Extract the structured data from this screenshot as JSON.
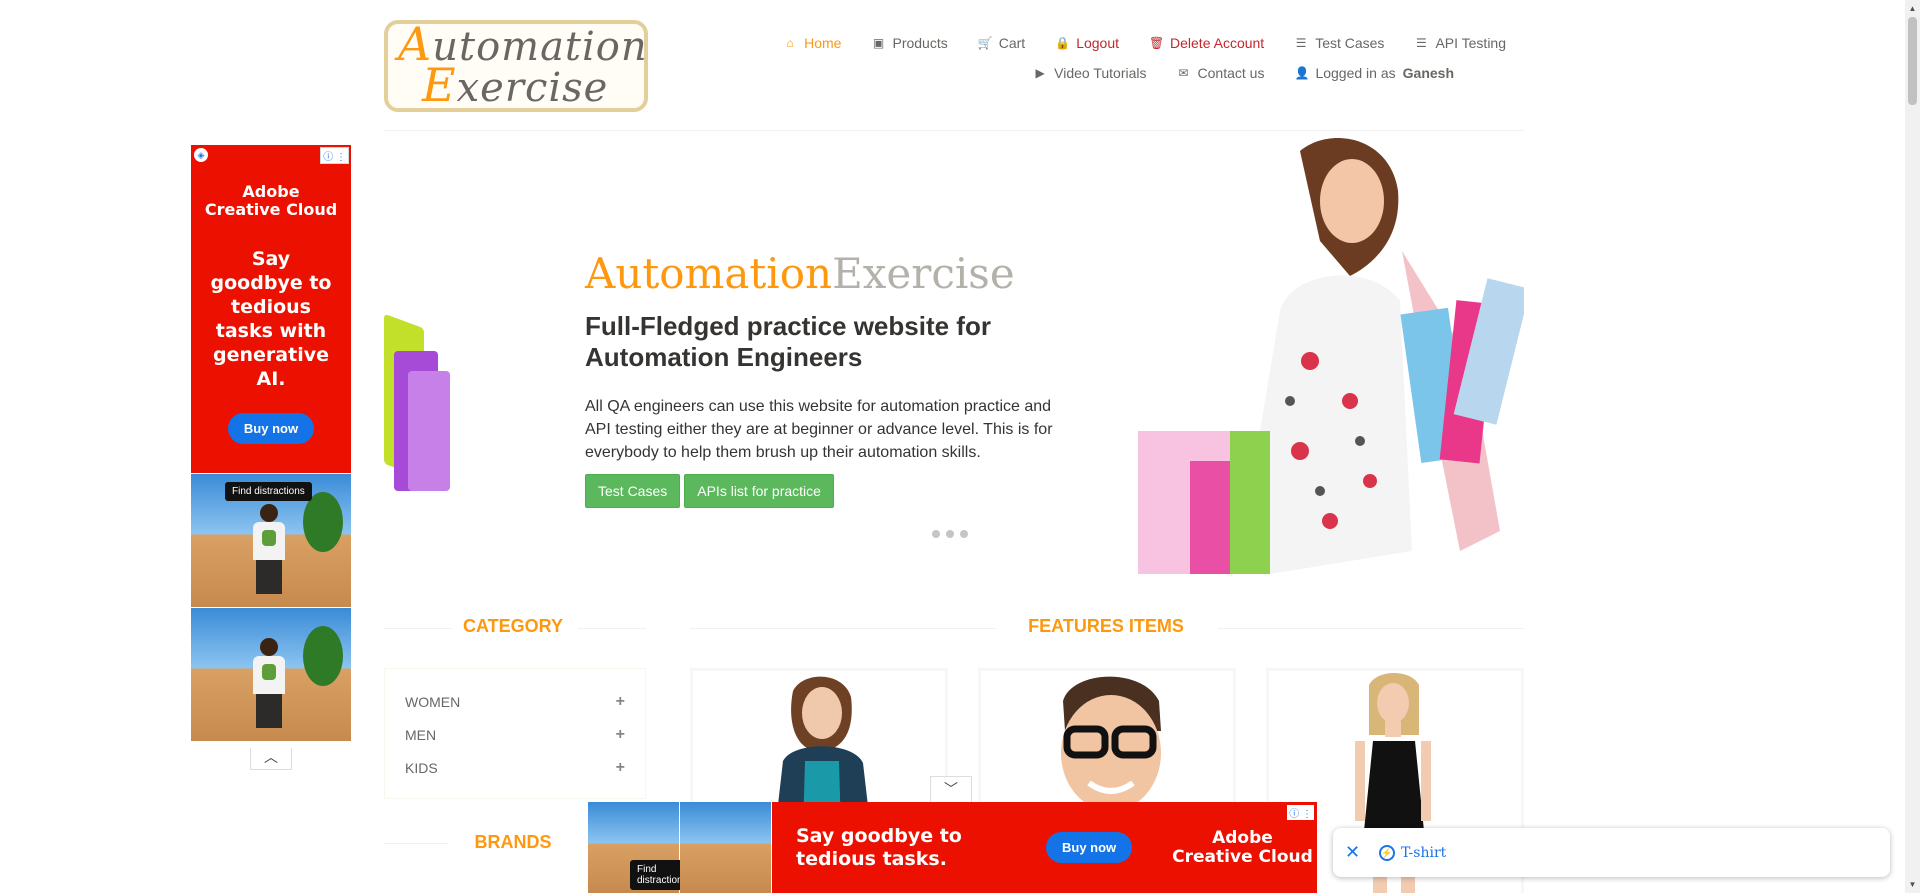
{
  "header": {
    "logo_line1_cap": "A",
    "logo_line1_rest": "utomation",
    "logo_line2_cap": "E",
    "logo_line2_rest": "xercise",
    "nav_row1": [
      {
        "icon": "home-icon",
        "glyph": "⌂",
        "label": "Home"
      },
      {
        "icon": "briefcase-icon",
        "glyph": "▣",
        "label": "Products"
      },
      {
        "icon": "cart-icon",
        "glyph": "🛒",
        "label": "Cart"
      },
      {
        "icon": "lock-icon",
        "glyph": "🔒",
        "label": "Logout"
      },
      {
        "icon": "trash-icon",
        "glyph": "🗑",
        "label": "Delete Account"
      },
      {
        "icon": "list-icon",
        "glyph": "☰",
        "label": "Test Cases"
      },
      {
        "icon": "list-icon",
        "glyph": "☰",
        "label": "API Testing"
      }
    ],
    "nav_row2": [
      {
        "icon": "video-icon",
        "glyph": "▶",
        "label": "Video Tutorials"
      },
      {
        "icon": "envelope-icon",
        "glyph": "✉",
        "label": "Contact us"
      },
      {
        "icon": "user-icon",
        "glyph": "👤",
        "label": "Logged in as",
        "user": "Ganesh"
      }
    ]
  },
  "slider": {
    "title_a": "Automation",
    "title_b": "Exercise",
    "subtitle": "Full-Fledged practice website for Automation Engineers",
    "description": "All QA engineers can use this website for automation practice and API testing either they are at beginner or advance level. This is for everybody to help them brush up their automation skills.",
    "btn_test_cases": "Test Cases",
    "btn_apis": "APIs list for practice",
    "active_slide": 1,
    "slide_count": 3
  },
  "category": {
    "title": "CATEGORY",
    "items": [
      "WOMEN",
      "MEN",
      "KIDS"
    ]
  },
  "brands": {
    "title": "BRANDS"
  },
  "features": {
    "title": "FEATURES ITEMS"
  },
  "ads": {
    "left": {
      "brand_line1": "Adobe",
      "brand_line2": "Creative Cloud",
      "headline": "Say goodbye to tedious tasks with generative AI.",
      "cta": "Buy now",
      "find": "Find distractions",
      "adchoice": "ⓘ ⋮"
    },
    "bottom": {
      "headline": "Say goodbye to tedious tasks.",
      "cta": "Buy now",
      "brand_line1": "Adobe",
      "brand_line2": "Creative Cloud",
      "find": "Find distractions",
      "adchoice": "ⓘ ⋮"
    }
  },
  "search_chip": {
    "close": "✕",
    "text": "T-shirt"
  },
  "colors": {
    "accent": "#fe980f",
    "danger": "#c1282d",
    "button_green": "#5cb85c",
    "ad_red": "#eb1000",
    "ad_blue": "#1473e6"
  }
}
